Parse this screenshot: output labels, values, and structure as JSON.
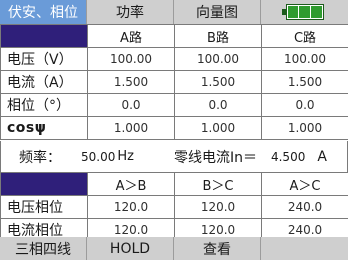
{
  "tabs": [
    "伏安、相位",
    "功率",
    "向量图",
    ""
  ],
  "battery": {
    "level": 1.0,
    "color": "#2f9b2f"
  },
  "measure": {
    "headers": [
      "A路",
      "B路",
      "C路"
    ],
    "rows": [
      {
        "label": "电压（V）",
        "values": [
          "100.00",
          "100.00",
          "100.00"
        ]
      },
      {
        "label": "电流（A）",
        "values": [
          "1.500",
          "1.500",
          "1.500"
        ]
      },
      {
        "label": "相位（°）",
        "values": [
          "0.0",
          "0.0",
          "0.0"
        ]
      },
      {
        "label": "cosψ",
        "values": [
          "1.000",
          "1.000",
          "1.000"
        ]
      }
    ]
  },
  "frequency": {
    "label": "频率：",
    "value": "50.00",
    "unit": "Hz"
  },
  "zero_current": {
    "label": "零线电流In＝",
    "value": "4.500",
    "unit": "A"
  },
  "phase": {
    "headers": [
      "A＞B",
      "B＞C",
      "A＞C"
    ],
    "rows": [
      {
        "label": "电压相位",
        "values": [
          "120.0",
          "120.0",
          "240.0"
        ]
      },
      {
        "label": "电流相位",
        "values": [
          "120.0",
          "120.0",
          "240.0"
        ]
      }
    ]
  },
  "buttons": [
    "三相四线",
    "HOLD",
    "查看",
    ""
  ],
  "colors": {
    "active_tab": "#6a9bd8",
    "corner": "#2f1f7a",
    "bar": "#cfcfcf"
  }
}
